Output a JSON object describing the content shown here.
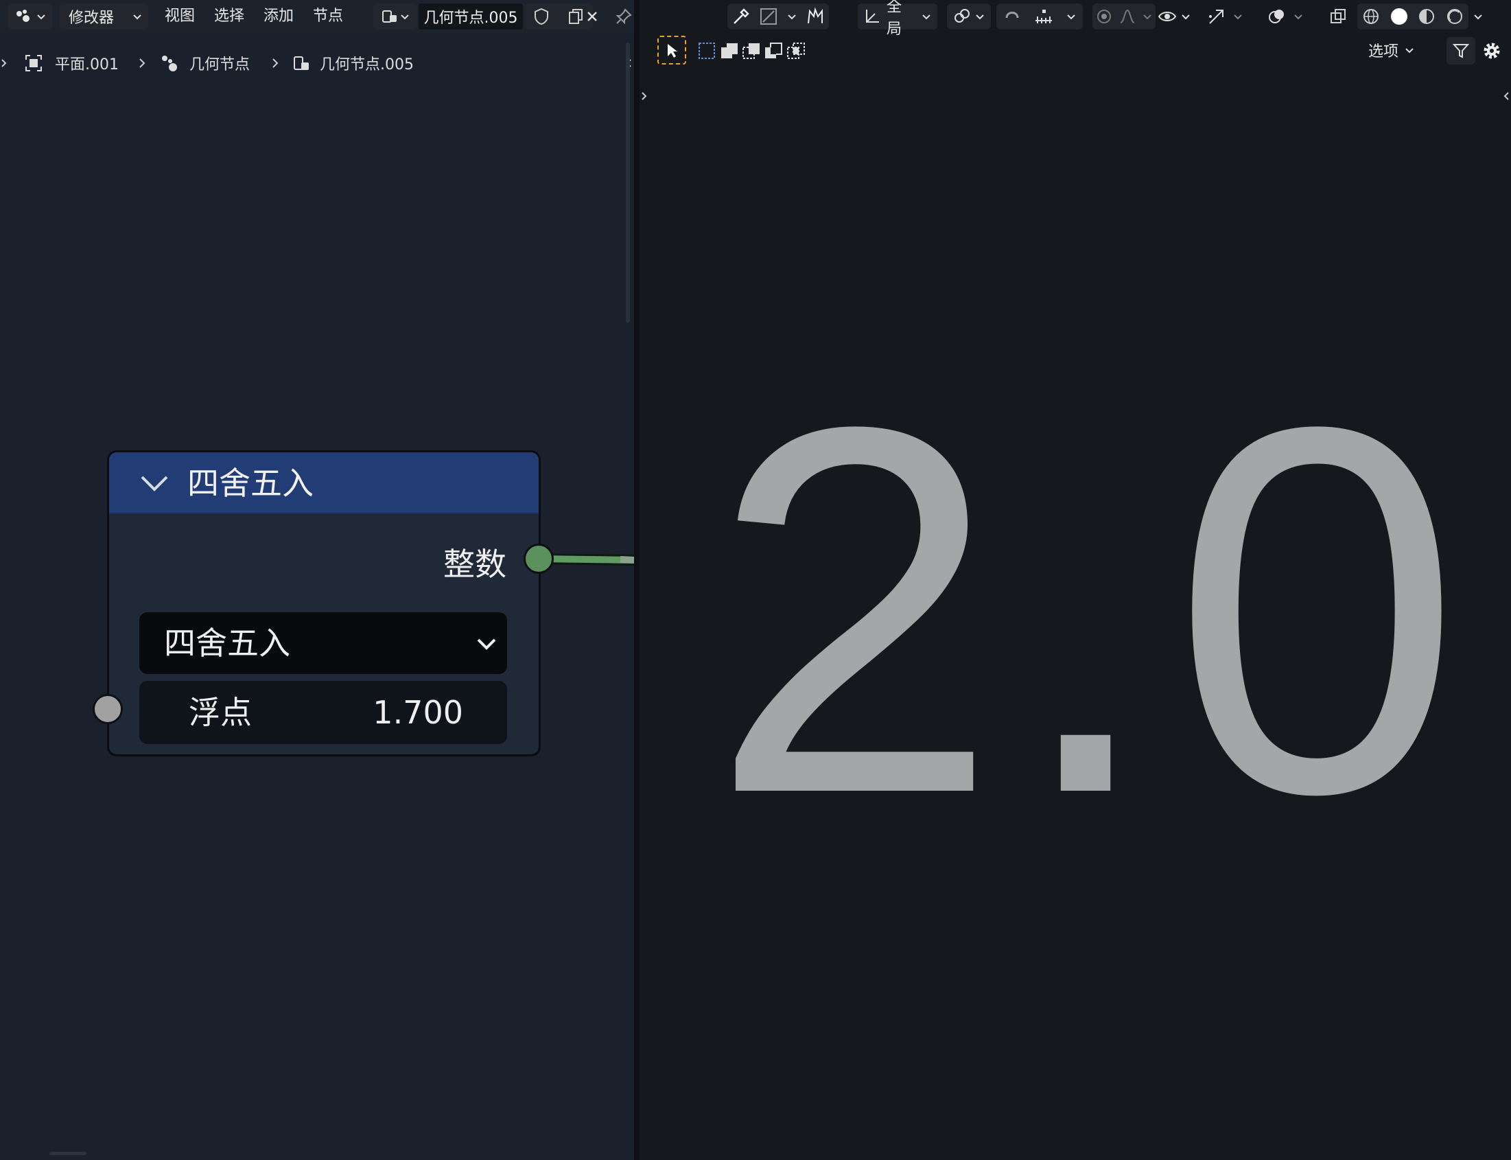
{
  "node_editor": {
    "header": {
      "mode_dropdown": "修改器",
      "menus": [
        "视图",
        "选择",
        "添加",
        "节点"
      ],
      "node_tree_name": "几何节点.005"
    },
    "breadcrumb": {
      "object": "平面.001",
      "modifier": "几何节点",
      "node_tree": "几何节点.005"
    },
    "node": {
      "title": "四舍五入",
      "output_label": "整数",
      "mode_value": "四舍五入",
      "input_label": "浮点",
      "input_value": "1.700"
    }
  },
  "viewport": {
    "header": {
      "orientation": "全局",
      "options_label": "选项"
    },
    "display_text": "2.0"
  },
  "colors": {
    "node_header": "#223c76",
    "int_socket": "#5b915c",
    "float_socket": "#a1a1a1",
    "text_object": "#a5a6a7",
    "select_box_accent": "#f1a21a"
  },
  "icons": [
    "editor-type-icon",
    "shield-icon",
    "duplicate-icon",
    "close-icon",
    "pin-icon",
    "eyedropper-icon",
    "snap-icon",
    "transform-orientation-icon",
    "pivot-icon",
    "proportional-icon",
    "visibility-icon",
    "gizmo-icon",
    "overlay-icon",
    "xray-icon",
    "wireframe-shading-icon",
    "solid-shading-icon",
    "material-shading-icon",
    "rendered-shading-icon",
    "filter-icon",
    "gear-icon"
  ]
}
